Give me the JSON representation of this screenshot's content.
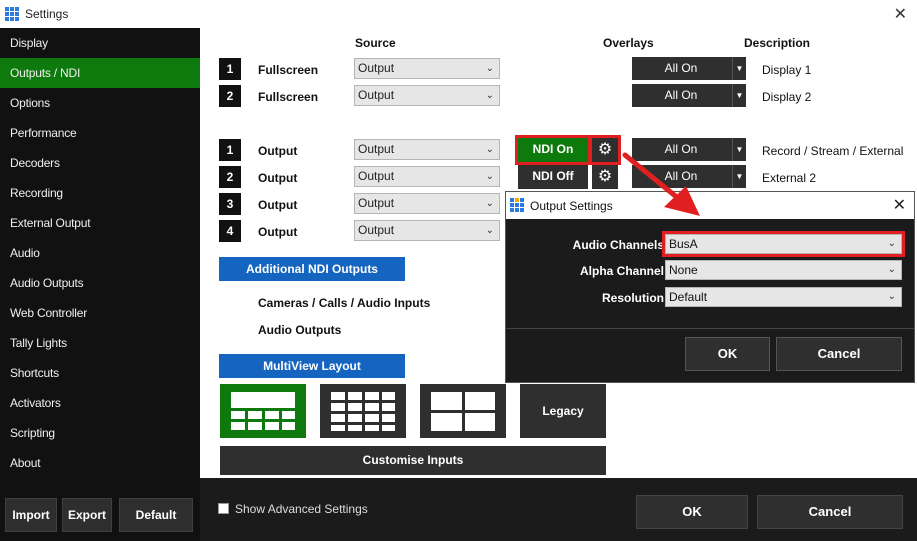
{
  "window": {
    "title": "Settings",
    "close_glyph": "✕"
  },
  "colors": {
    "green": "#0e7a0d",
    "blue": "#1565c0",
    "highlight": "#e02020",
    "dark": "#2f2f2f"
  },
  "sidebar": {
    "items": [
      {
        "label": "Display"
      },
      {
        "label": "Outputs / NDI",
        "active": true
      },
      {
        "label": "Options"
      },
      {
        "label": "Performance"
      },
      {
        "label": "Decoders"
      },
      {
        "label": "Recording"
      },
      {
        "label": "External Output"
      },
      {
        "label": "Audio"
      },
      {
        "label": "Audio Outputs"
      },
      {
        "label": "Web Controller"
      },
      {
        "label": "Tally Lights"
      },
      {
        "label": "Shortcuts"
      },
      {
        "label": "Activators"
      },
      {
        "label": "Scripting"
      },
      {
        "label": "About"
      }
    ],
    "buttons": {
      "import": "Import",
      "export": "Export",
      "default": "Default"
    }
  },
  "main": {
    "headers": {
      "source": "Source",
      "overlays": "Overlays",
      "description": "Description"
    },
    "fullscreen_rows": [
      {
        "num": "1",
        "label": "Fullscreen",
        "source": "Output",
        "overlay": "All On",
        "description": "Display 1"
      },
      {
        "num": "2",
        "label": "Fullscreen",
        "source": "Output",
        "overlay": "All On",
        "description": "Display 2"
      }
    ],
    "output_rows": [
      {
        "num": "1",
        "label": "Output",
        "source": "Output",
        "ndi": "NDI On",
        "overlay": "All On",
        "description": "Record / Stream / External"
      },
      {
        "num": "2",
        "label": "Output",
        "source": "Output",
        "ndi": "NDI Off",
        "overlay": "All On",
        "description": "External 2"
      },
      {
        "num": "3",
        "label": "Output",
        "source": "Output"
      },
      {
        "num": "4",
        "label": "Output",
        "source": "Output"
      }
    ],
    "additional_ndi": "Additional NDI Outputs",
    "cameras_calls": "Cameras / Calls / Audio Inputs",
    "audio_outputs": "Audio Outputs",
    "multiview": "MultiView Layout",
    "legacy": "Legacy",
    "customise": "Customise Inputs"
  },
  "footer": {
    "show_advanced": "Show Advanced Settings",
    "ok": "OK",
    "cancel": "Cancel"
  },
  "dialog": {
    "title": "Output Settings",
    "close_glyph": "✕",
    "audio_channels_label": "Audio Channels",
    "audio_channels_value": "BusA",
    "alpha_channel_label": "Alpha Channel",
    "alpha_channel_value": "None",
    "resolution_label": "Resolution",
    "resolution_value": "Default",
    "ok": "OK",
    "cancel": "Cancel"
  },
  "icons": {
    "chevron": "chevron-down-icon",
    "gear": "gear-icon",
    "arrow": "red-arrow-annotation"
  }
}
